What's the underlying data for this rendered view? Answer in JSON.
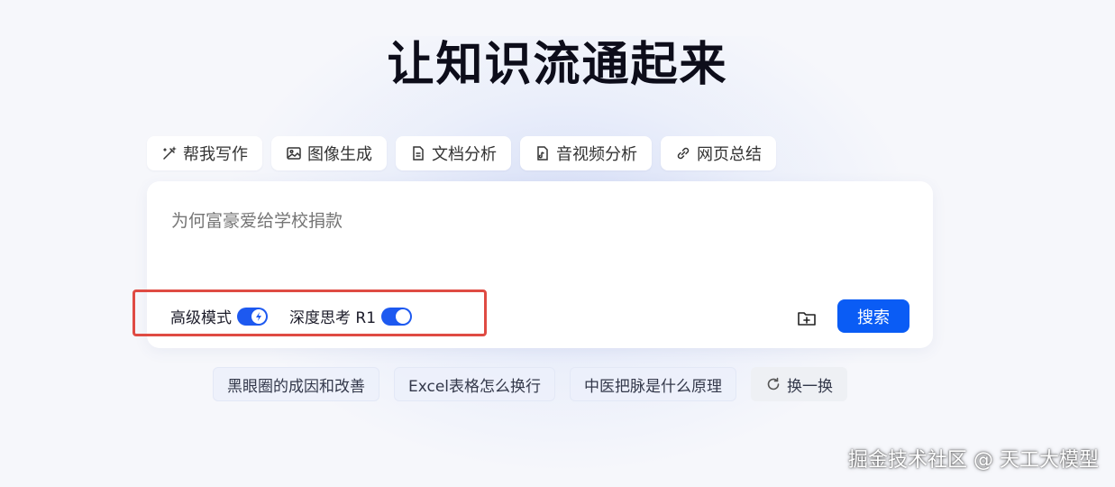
{
  "page": {
    "title": "让知识流通起来"
  },
  "tools": [
    {
      "label": "帮我写作",
      "icon": "magic-pen-icon"
    },
    {
      "label": "图像生成",
      "icon": "image-icon"
    },
    {
      "label": "文档分析",
      "icon": "document-icon"
    },
    {
      "label": "音视频分析",
      "icon": "media-file-icon"
    },
    {
      "label": "网页总结",
      "icon": "link-icon"
    }
  ],
  "search": {
    "placeholder": "为何富豪爱给学校捐款",
    "button_label": "搜索",
    "upload_icon": "folder-add-icon"
  },
  "toggles": [
    {
      "label": "高级模式",
      "on": true,
      "icon": "lightning-icon"
    },
    {
      "label": "深度思考 R1",
      "on": true
    }
  ],
  "suggestions": [
    "黑眼圈的成因和改善",
    "Excel表格怎么换行",
    "中医把脉是什么原理"
  ],
  "refresh": {
    "label": "换一换",
    "icon": "refresh-icon"
  },
  "watermark": "掘金技术社区 @ 天工大模型",
  "colors": {
    "accent": "#0a5cf5",
    "highlight_border": "#df4b43",
    "background": "#f6f7fb"
  }
}
